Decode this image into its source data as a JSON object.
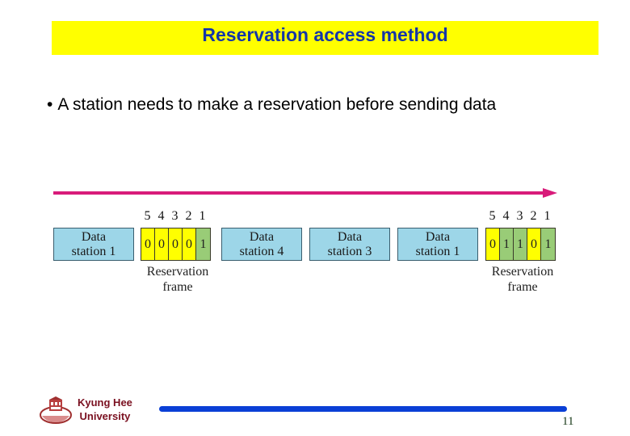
{
  "slide": {
    "title": "Reservation access method",
    "bullet": "A station needs to make a reservation before sending data",
    "bullet_symbol": "•"
  },
  "diagram": {
    "slot_numbers": [
      "5",
      "4",
      "3",
      "2",
      "1"
    ],
    "data_frames": [
      {
        "line1": "Data",
        "line2": "station 1"
      },
      {
        "line1": "Data",
        "line2": "station 4"
      },
      {
        "line1": "Data",
        "line2": "station 3"
      },
      {
        "line1": "Data",
        "line2": "station 1"
      }
    ],
    "reservation_frames": [
      {
        "bits": [
          "0",
          "0",
          "0",
          "0",
          "1"
        ],
        "caption_line1": "Reservation",
        "caption_line2": "frame"
      },
      {
        "bits": [
          "0",
          "1",
          "1",
          "0",
          "1"
        ],
        "caption_line1": "Reservation",
        "caption_line2": "frame"
      }
    ],
    "colors": {
      "arrow": "#d81b7a",
      "data_box": "#9dd6e8",
      "bit_zero": "#ffff00",
      "bit_one": "#99cc77"
    }
  },
  "footer": {
    "university_line1": "Kyung Hee",
    "university_line2": "University",
    "page_number": "11"
  }
}
